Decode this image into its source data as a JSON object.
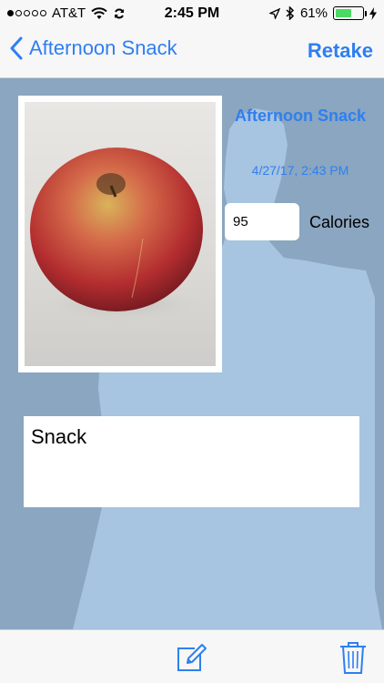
{
  "status_bar": {
    "carrier": "AT&T",
    "time": "2:45 PM",
    "battery_percent": "61%",
    "battery_level": 0.61,
    "signal_bars_filled": 1,
    "signal_bars_total": 5,
    "icons": [
      "wifi-icon",
      "sync-icon",
      "location-icon",
      "bluetooth-icon",
      "battery-icon",
      "charging-icon"
    ]
  },
  "nav": {
    "back_label": "Afternoon Snack",
    "retake_label": "Retake"
  },
  "meal": {
    "title": "Afternoon Snack",
    "datetime": "4/27/17, 2:43 PM",
    "calories_value": "95",
    "calories_label": "Calories",
    "notes": "Snack"
  },
  "toolbar": {
    "icons": [
      "compose-icon",
      "trash-icon"
    ]
  },
  "colors": {
    "accent": "#2f7ff0",
    "background": "#8aa6c0",
    "silhouette": "#a7c4e0",
    "bar": "#f7f7f7"
  }
}
